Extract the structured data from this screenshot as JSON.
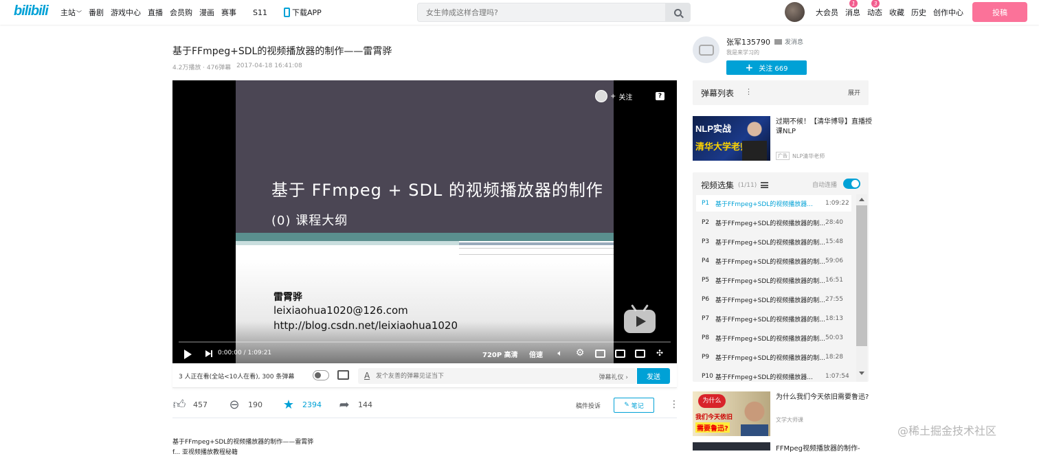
{
  "header": {
    "logo": "bilibili",
    "nav": [
      "主站",
      "番剧",
      "游戏中心",
      "直播",
      "会员购",
      "漫画",
      "赛事",
      "S11"
    ],
    "download": "下载APP",
    "search_placeholder": "女生帅成这样合理吗?",
    "right_nav": [
      {
        "label": "大会员",
        "badge": ""
      },
      {
        "label": "消息",
        "badge": "1"
      },
      {
        "label": "动态",
        "badge": "3"
      },
      {
        "label": "收藏",
        "badge": ""
      },
      {
        "label": "历史",
        "badge": ""
      },
      {
        "label": "创作中心",
        "badge": ""
      }
    ],
    "upload": "投稿",
    "accent": "#00a1d6",
    "pink": "#fb7299"
  },
  "video": {
    "title": "基于FFmpeg+SDL的视频播放器的制作——雷霄骅",
    "plays": "4.2万播放 · 476弹幕",
    "date": "2017-04-18 16:41:08"
  },
  "player": {
    "slide_title": "基于 FFmpeg + SDL 的视频播放器的制作",
    "slide_subtitle": "(0) 课程大纲",
    "author": "雷霄骅",
    "email": "leixiaohua1020@126.com",
    "blog": "http://blog.csdn.net/leixiaohua1020",
    "follow_overlay": "关注",
    "help": "?",
    "time": "0:00:00 / 1:09:21",
    "quality": "720P 高清",
    "speed": "倍速"
  },
  "danmaku_bar": {
    "watching": "3 人正在看(全站<10人在看), 300 条弹幕",
    "input_placeholder": "发个友善的弹幕见证当下",
    "etiquette": "弹幕礼仪 ›",
    "send": "发送"
  },
  "toolbar": {
    "like": "457",
    "coin": "190",
    "fav": "2394",
    "share": "144",
    "report": "稿件投诉",
    "note": "笔记"
  },
  "description": {
    "line1": "基于FFmpeg+SDL的视频播放器的制作——雷霄骅",
    "line2": "f... 亚视频播放教程秘籍"
  },
  "uploader": {
    "name": "张军135790",
    "message": "发消息",
    "sign": "我是来学习的",
    "follow": "关注 669"
  },
  "danmaku_list": {
    "title": "弹幕列表",
    "expand": "展开"
  },
  "ad": {
    "thumb_text1": "NLP实战",
    "thumb_text2": "清华大学老师",
    "title": "过期不候！【清华博导】直播授课NLP",
    "tag": "广告",
    "source": "NLP清华老师"
  },
  "episodes": {
    "title": "视频选集",
    "count": "(1/11)",
    "autoplay": "自动连播",
    "items": [
      {
        "p": "P1",
        "name": "基于FFmpeg+SDL的视频播放器...",
        "dur": "1:09:22"
      },
      {
        "p": "P2",
        "name": "基于FFmpeg+SDL的视频播放器的制...",
        "dur": "28:40"
      },
      {
        "p": "P3",
        "name": "基于FFmpeg+SDL的视频播放器的制...",
        "dur": "15:48"
      },
      {
        "p": "P4",
        "name": "基于FFmpeg+SDL的视频播放器的制...",
        "dur": "59:06"
      },
      {
        "p": "P5",
        "name": "基于FFmpeg+SDL的视频播放器的制...",
        "dur": "16:51"
      },
      {
        "p": "P6",
        "name": "基于FFmpeg+SDL的视频播放器的制...",
        "dur": "27:55"
      },
      {
        "p": "P7",
        "name": "基于FFmpeg+SDL的视频播放器的制...",
        "dur": "18:13"
      },
      {
        "p": "P8",
        "name": "基于FFmpeg+SDL的视频播放器的制...",
        "dur": "50:03"
      },
      {
        "p": "P9",
        "name": "基于FFmpeg+SDL的视频播放器的制...",
        "dur": "18:28"
      },
      {
        "p": "P10",
        "name": "基于FFmpeg+SDL的视频播放器...",
        "dur": "1:07:54"
      }
    ]
  },
  "recommend": [
    {
      "thumb_a": "为什么",
      "thumb_b": "我们今天依旧",
      "thumb_c": "需要鲁迅?",
      "title": "为什么我们今天依旧需要鲁迅?",
      "author": "文学大师课"
    },
    {
      "title": "FFMpeg视频播放器的制作-"
    }
  ],
  "watermark": "@稀土掘金技术社区"
}
